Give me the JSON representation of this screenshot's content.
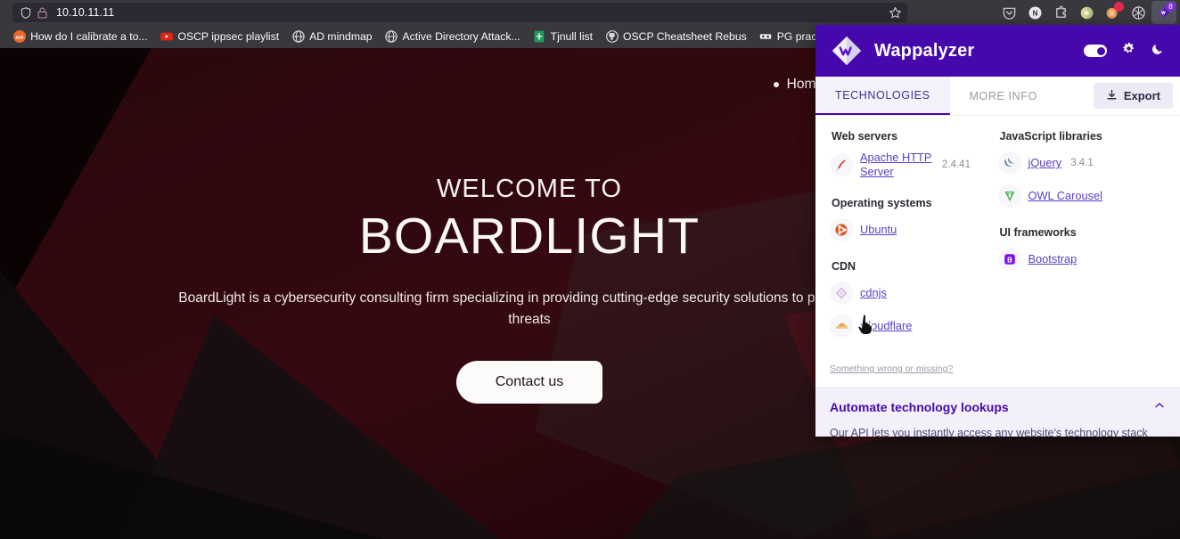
{
  "browser": {
    "url": "10.10.11.11",
    "url_icons": [
      "shield-icon",
      "lock-icon"
    ],
    "bookmark_star": "star-icon",
    "bookmarks": [
      {
        "label": "How do I calibrate a to...",
        "icon": "ask-icon",
        "color": "#e8682c"
      },
      {
        "label": "OSCP ippsec playlist",
        "icon": "youtube-icon",
        "color": "#e62117"
      },
      {
        "label": "AD mindmap",
        "icon": "globe-icon",
        "color": "#d7d7dd"
      },
      {
        "label": "Active Directory Attack...",
        "icon": "globe-icon",
        "color": "#d7d7dd"
      },
      {
        "label": "Tjnull list",
        "icon": "sheets-icon",
        "color": "#1e9e5a"
      },
      {
        "label": "OSCP Cheatsheet Rebus",
        "icon": "github-icon",
        "color": "#d7d7dd"
      },
      {
        "label": "PG practice Walk",
        "icon": "domain-icon",
        "color": "#f2f2f5"
      }
    ],
    "toolbar_icons": [
      {
        "name": "pocket-icon",
        "badge": ""
      },
      {
        "name": "notion-icon",
        "badge": ""
      },
      {
        "name": "extensions-puzzle-icon",
        "badge": ""
      },
      {
        "name": "colorzilla-icon",
        "badge": ""
      },
      {
        "name": "ublock-origin-icon",
        "badge": ""
      },
      {
        "name": "foxyproxy-icon",
        "badge": ""
      },
      {
        "name": "wappalyzer-icon",
        "badge": "8"
      }
    ]
  },
  "site": {
    "nav_link": "Home",
    "kicker": "WELCOME TO",
    "title": "BOARDLIGHT",
    "subtitle": "BoardLight is a cybersecurity consulting firm specializing in providing cutting-edge security solutions to protect your threats",
    "cta": "Contact us"
  },
  "wappalyzer": {
    "brand": "Wappalyzer",
    "header_icons": [
      "toggle-switch",
      "gear-icon",
      "moon-icon"
    ],
    "tabs": [
      {
        "label": "TECHNOLOGIES",
        "active": true
      },
      {
        "label": "MORE INFO",
        "active": false
      }
    ],
    "export_label": "Export",
    "export_icon": "download-icon",
    "columns": [
      {
        "categories": [
          {
            "title": "Web servers",
            "items": [
              {
                "name": "Apache HTTP Server",
                "version": "2.4.41",
                "icon": "apache-feather-icon"
              }
            ]
          },
          {
            "title": "Operating systems",
            "items": [
              {
                "name": "Ubuntu",
                "version": "",
                "icon": "ubuntu-icon"
              }
            ]
          },
          {
            "title": "CDN",
            "items": [
              {
                "name": "cdnjs",
                "version": "",
                "icon": "cdnjs-icon"
              },
              {
                "name": "Cloudflare",
                "version": "",
                "icon": "cloudflare-icon"
              }
            ]
          }
        ]
      },
      {
        "categories": [
          {
            "title": "JavaScript libraries",
            "items": [
              {
                "name": "jQuery",
                "version": "3.4.1",
                "icon": "jquery-icon"
              },
              {
                "name": "OWL Carousel",
                "version": "",
                "icon": "owl-carousel-icon"
              }
            ]
          },
          {
            "title": "UI frameworks",
            "items": [
              {
                "name": "Bootstrap",
                "version": "",
                "icon": "bootstrap-icon"
              }
            ]
          }
        ]
      }
    ],
    "report_link": "Something wrong or missing?",
    "promo": {
      "title": "Automate technology lookups",
      "collapse_icon": "chevron-up-icon",
      "text": "Our API lets you instantly access any website's technology stack"
    }
  },
  "colors": {
    "brand_purple": "#4608ad",
    "link_purple": "#5b3fc4",
    "chrome_bg": "#38383d",
    "urlbar_bg": "#2b2a33",
    "hero_dark": "#1a0407"
  }
}
